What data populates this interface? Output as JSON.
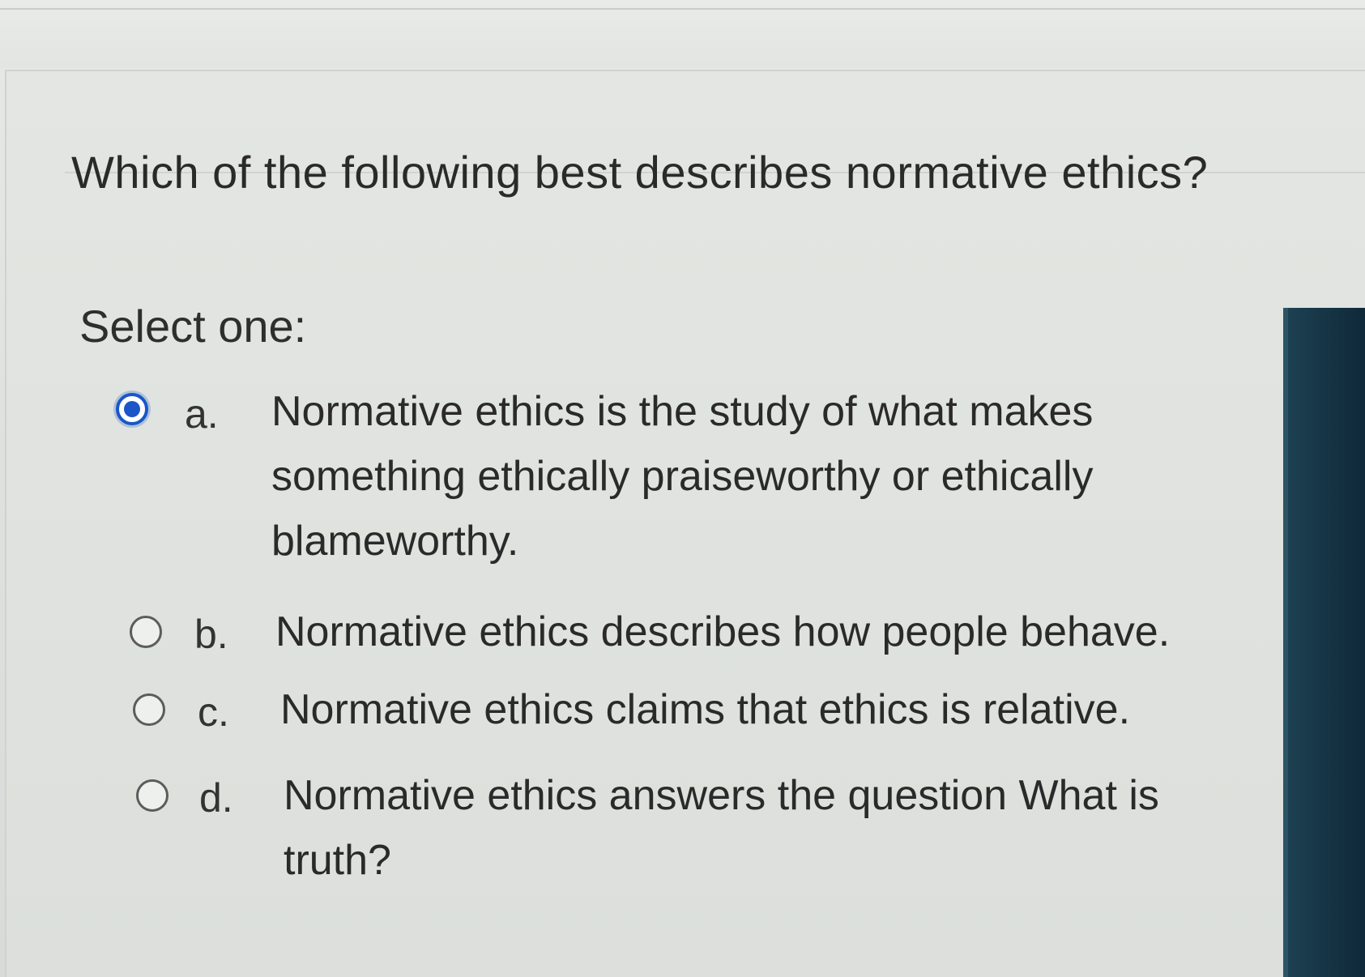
{
  "question": {
    "text": "Which of the following best describes normative ethics?"
  },
  "prompt": "Select one:",
  "options": [
    {
      "letter": "a.",
      "text": "Normative ethics is the study of what makes something ethically praiseworthy or ethically blameworthy.",
      "selected": true
    },
    {
      "letter": "b.",
      "text": "Normative ethics describes how people behave.",
      "selected": false
    },
    {
      "letter": "c.",
      "text": "Normative ethics claims that ethics is relative.",
      "selected": false
    },
    {
      "letter": "d.",
      "text": "Normative ethics answers the question What is truth?",
      "selected": false
    }
  ],
  "colors": {
    "selected_radio": "#1a56c8",
    "side_bar": "#143242"
  }
}
